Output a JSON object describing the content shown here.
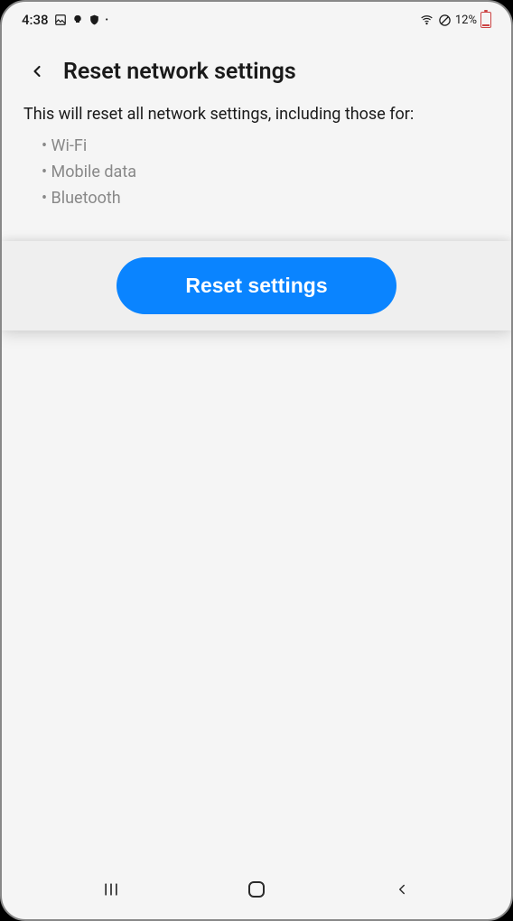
{
  "status": {
    "time": "4:38",
    "battery_pct": "12%"
  },
  "header": {
    "title": "Reset network settings"
  },
  "body": {
    "intro": "This will reset all network settings, including those for:",
    "bullets": {
      "b0": "Wi-Fi",
      "b1": "Mobile data",
      "b2": "Bluetooth"
    }
  },
  "actions": {
    "reset_label": "Reset settings"
  }
}
